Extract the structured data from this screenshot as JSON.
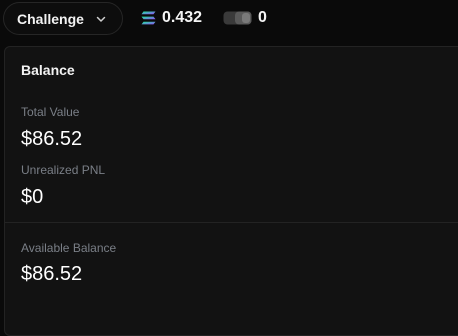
{
  "topbar": {
    "mode": {
      "label": "Challenge"
    },
    "sol_balance": {
      "icon": "solana-icon",
      "value": "0.432"
    },
    "token_count": {
      "icon": "token-toggle-icon",
      "value": "0"
    }
  },
  "balance_panel": {
    "title": "Balance",
    "total_value": {
      "label": "Total Value",
      "value": "$86.52"
    },
    "unrealized_pnl": {
      "label": "Unrealized PNL",
      "value": "$0"
    },
    "available_balance": {
      "label": "Available Balance",
      "value": "$86.52"
    }
  },
  "colors": {
    "background": "#0a0a0a",
    "panel": "#121212",
    "border": "#232323",
    "muted_text": "#7a7f87",
    "solana_gradient": [
      "#14f195",
      "#9945ff"
    ]
  }
}
